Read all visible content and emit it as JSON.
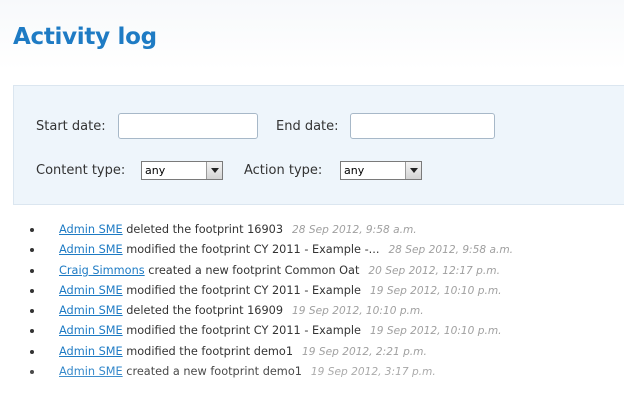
{
  "page": {
    "title": "Activity log"
  },
  "filters": {
    "start_date_label": "Start date:",
    "start_date_value": "",
    "end_date_label": "End date:",
    "end_date_value": "",
    "content_type_label": "Content type:",
    "content_type_value": "any",
    "action_type_label": "Action type:",
    "action_type_value": "any"
  },
  "activities": [
    {
      "user": "Admin SME",
      "action": "deleted the footprint 16903",
      "time": "28 Sep 2012, 9:58 a.m."
    },
    {
      "user": "Admin SME",
      "action": "modified the footprint CY 2011 - Example -...",
      "time": "28 Sep 2012, 9:58 a.m."
    },
    {
      "user": "Craig Simmons",
      "action": "created a new footprint Common Oat",
      "time": "20 Sep 2012, 12:17 p.m."
    },
    {
      "user": "Admin SME",
      "action": "modified the footprint CY 2011 - Example",
      "time": "19 Sep 2012, 10:10 p.m."
    },
    {
      "user": "Admin SME",
      "action": "deleted the footprint 16909",
      "time": "19 Sep 2012, 10:10 p.m."
    },
    {
      "user": "Admin SME",
      "action": "modified the footprint CY 2011 - Example",
      "time": "19 Sep 2012, 10:10 p.m."
    },
    {
      "user": "Admin SME",
      "action": "modified the footprint demo1",
      "time": "19 Sep 2012, 2:21 p.m."
    },
    {
      "user": "Admin SME",
      "action": "created a new footprint demo1",
      "time": "19 Sep 2012, 3:17 p.m."
    }
  ],
  "colors": {
    "title": "#1e7bc4",
    "link": "#1e7bc4",
    "panel_background": "#eef5fb",
    "timestamp": "#a0a0a0"
  },
  "icons": {
    "select_arrow": "triangle-down-icon",
    "bullet": "bullet-icon"
  }
}
